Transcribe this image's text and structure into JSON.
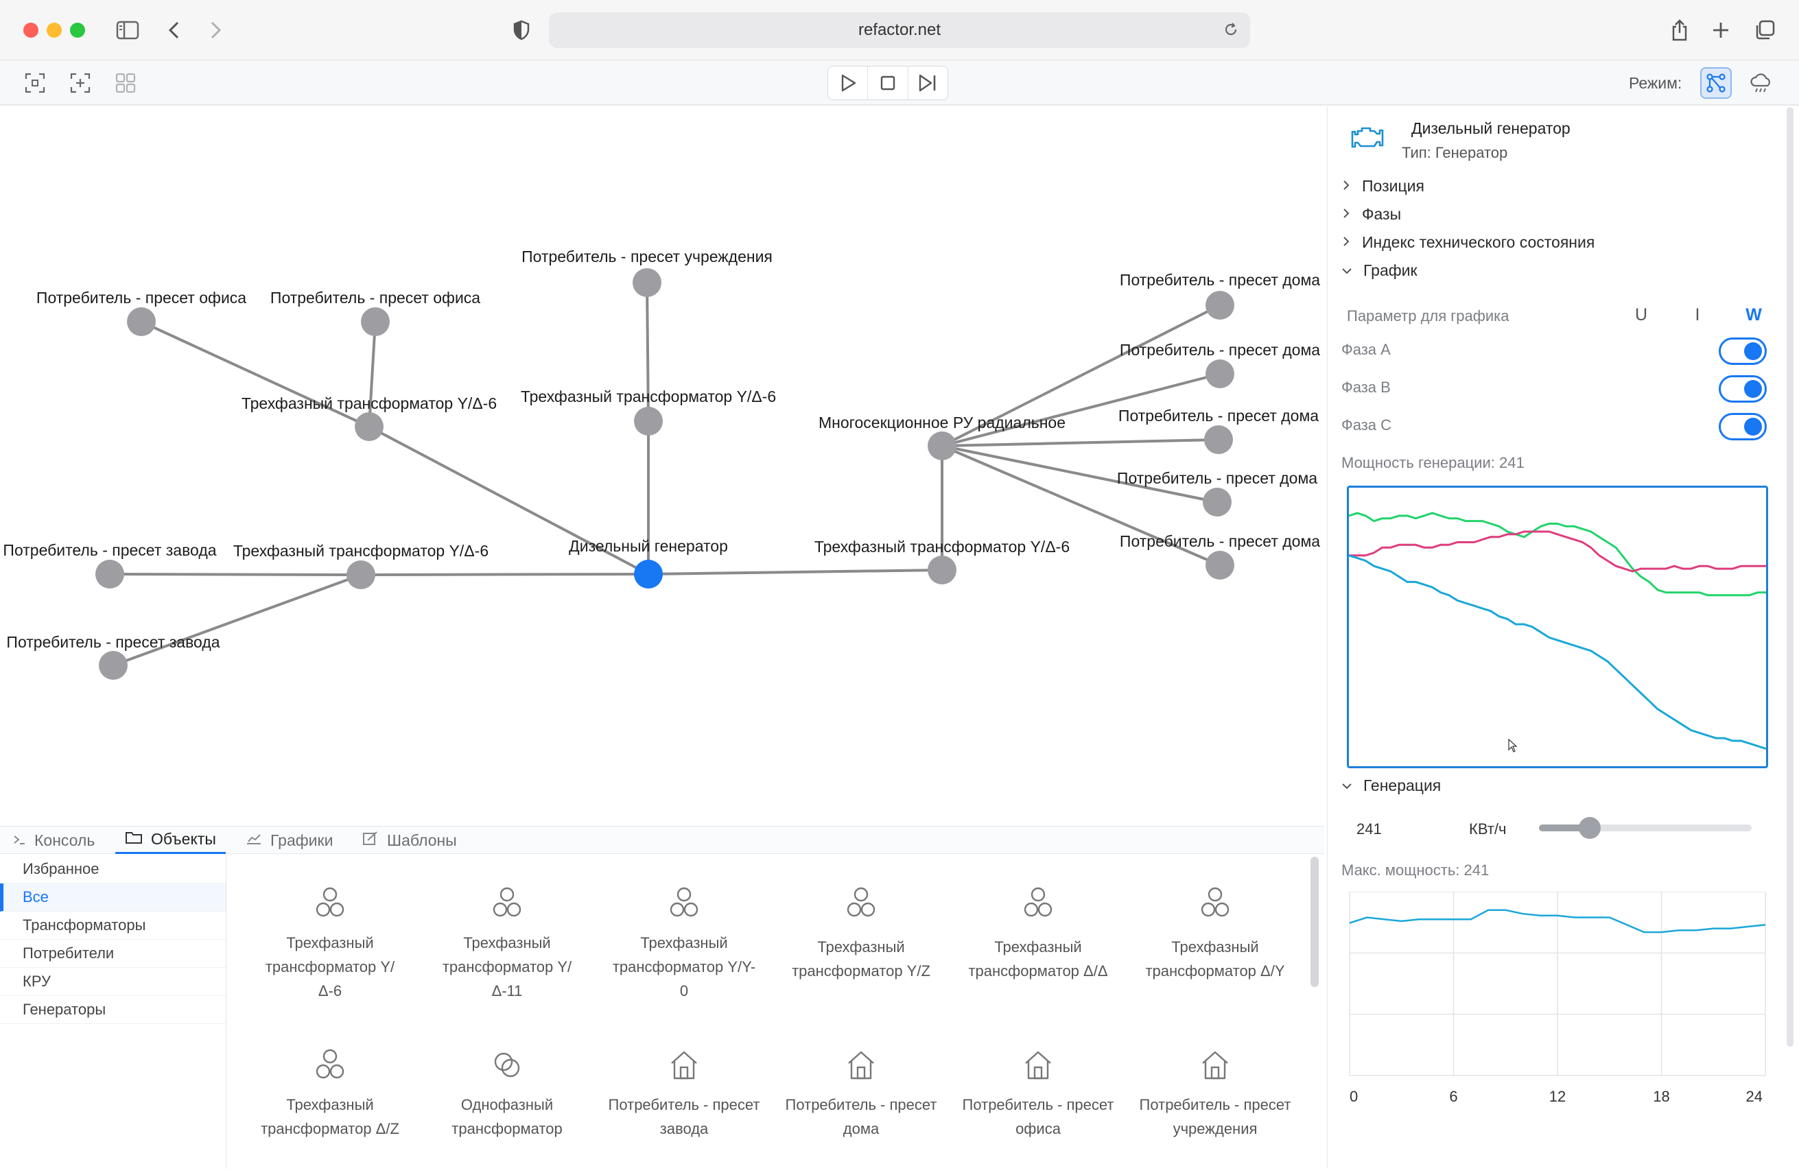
{
  "browser": {
    "url": "refactor.net"
  },
  "toolbar": {
    "mode_label": "Режим:"
  },
  "graph": {
    "nodes": [
      {
        "id": "gen",
        "label": "Дизельный генератор",
        "selected": true
      },
      {
        "id": "t1",
        "label": "Трехфазный трансформатор Y/Δ-6"
      },
      {
        "id": "t2",
        "label": "Трехфазный трансформатор Y/Δ-6"
      },
      {
        "id": "t3",
        "label": "Трехфазный трансформатор Y/Δ-6"
      },
      {
        "id": "t4",
        "label": "Трехфазный трансформатор Y/Δ-6"
      },
      {
        "id": "ru",
        "label": "Многосекционное РУ радиальное"
      },
      {
        "id": "o1",
        "label": "Потребитель - пресет офиса"
      },
      {
        "id": "o2",
        "label": "Потребитель - пресет офиса"
      },
      {
        "id": "u1",
        "label": "Потребитель - пресет учреждения"
      },
      {
        "id": "z1",
        "label": "Потребитель - пресет завода"
      },
      {
        "id": "z2",
        "label": "Потребитель - пресет завода"
      },
      {
        "id": "h1",
        "label": "Потребитель - пресет дома"
      },
      {
        "id": "h2",
        "label": "Потребитель - пресет дома"
      },
      {
        "id": "h3",
        "label": "Потребитель - пресет дома"
      },
      {
        "id": "h4",
        "label": "Потребитель - пресет дома"
      },
      {
        "id": "h5",
        "label": "Потребитель - пресет дома"
      }
    ],
    "edges": [
      [
        "gen",
        "t1"
      ],
      [
        "t1",
        "o1"
      ],
      [
        "t1",
        "o2"
      ],
      [
        "gen",
        "t2"
      ],
      [
        "t2",
        "u1"
      ],
      [
        "gen",
        "t3"
      ],
      [
        "t3",
        "z1"
      ],
      [
        "t3",
        "z2"
      ],
      [
        "gen",
        "t4"
      ],
      [
        "t4",
        "ru"
      ],
      [
        "ru",
        "h1"
      ],
      [
        "ru",
        "h2"
      ],
      [
        "ru",
        "h3"
      ],
      [
        "ru",
        "h4"
      ],
      [
        "ru",
        "h5"
      ]
    ],
    "colors": {
      "node": "#9e9ea2",
      "selected": "#1877f2",
      "edge": "#8a8a8d"
    }
  },
  "bottom": {
    "tabs": [
      {
        "label": "Консоль",
        "icon": "terminal-icon"
      },
      {
        "label": "Объекты",
        "icon": "folder-icon",
        "active": true
      },
      {
        "label": "Графики",
        "icon": "chart-icon"
      },
      {
        "label": "Шаблоны",
        "icon": "template-icon"
      }
    ],
    "categories": [
      {
        "label": "Избранное"
      },
      {
        "label": "Все",
        "active": true
      },
      {
        "label": "Трансформаторы"
      },
      {
        "label": "Потребители"
      },
      {
        "label": "КРУ"
      },
      {
        "label": "Генераторы"
      }
    ],
    "objects": [
      {
        "label": "Трехфазный трансформатор Y/Δ-6",
        "icon": "three-circles-icon"
      },
      {
        "label": "Трехфазный трансформатор Y/Δ-11",
        "icon": "three-circles-icon"
      },
      {
        "label": "Трехфазный трансформатор Y/Y-0",
        "icon": "three-circles-icon"
      },
      {
        "label": "Трехфазный трансформатор Y/Z",
        "icon": "three-circles-icon"
      },
      {
        "label": "Трехфазный трансформатор Δ/Δ",
        "icon": "three-circles-icon"
      },
      {
        "label": "Трехфазный трансформатор Δ/Y",
        "icon": "three-circles-icon"
      },
      {
        "label": "Трехфазный трансформатор Δ/Z",
        "icon": "three-circles-icon"
      },
      {
        "label": "Однофазный трансформатор",
        "icon": "two-circles-icon"
      },
      {
        "label": "Потребитель - пресет завода",
        "icon": "house-icon"
      },
      {
        "label": "Потребитель - пресет дома",
        "icon": "house-icon"
      },
      {
        "label": "Потребитель - пресет офиса",
        "icon": "house-icon"
      },
      {
        "label": "Потребитель - пресет учреждения",
        "icon": "house-icon"
      }
    ]
  },
  "panel": {
    "title": "Дизельный генератор",
    "type": "Тип: Генератор",
    "sections": [
      "Позиция",
      "Фазы",
      "Индекс технического состояния",
      "График"
    ],
    "param_label": "Параметр для графика",
    "params": [
      {
        "label": "U"
      },
      {
        "label": "I"
      },
      {
        "label": "W",
        "active": true
      }
    ],
    "phases": [
      {
        "label": "Фаза A",
        "on": true
      },
      {
        "label": "Фаза B",
        "on": true
      },
      {
        "label": "Фаза C",
        "on": true
      }
    ],
    "power_label": "Мощность генерации: 241",
    "generation_section": "Генерация",
    "gen_value": "241",
    "gen_unit": "КВт/ч",
    "gen_slider": 0.24,
    "max_power_label": "Макс. мощность: 241",
    "accent": "#1877f2"
  },
  "chart_data": [
    {
      "type": "line",
      "ylim": [
        0,
        100
      ],
      "series": [
        {
          "color": "#22d36b",
          "values": [
            92,
            93,
            92,
            90,
            91,
            91,
            92,
            92,
            91,
            92,
            93,
            92,
            91,
            91,
            90,
            90,
            90,
            89,
            88,
            86,
            85,
            84,
            86,
            88,
            89,
            89,
            88,
            88,
            87,
            86,
            84,
            82,
            80,
            76,
            72,
            69,
            67,
            64,
            63,
            63,
            63,
            63,
            63,
            62,
            62,
            62,
            62,
            62,
            62,
            63,
            63
          ]
        },
        {
          "color": "#de3d7e",
          "values": [
            77,
            77,
            77,
            78,
            80,
            80,
            81,
            81,
            81,
            80,
            80,
            81,
            81,
            82,
            82,
            82,
            83,
            84,
            84,
            85,
            85,
            86,
            86,
            86,
            86,
            85,
            84,
            83,
            82,
            80,
            77,
            75,
            73,
            72,
            71,
            72,
            72,
            72,
            72,
            73,
            72,
            72,
            73,
            73,
            72,
            72,
            72,
            73,
            73,
            73,
            73
          ]
        },
        {
          "color": "#1aa7d8",
          "values": [
            77,
            76,
            75,
            73,
            72,
            71,
            69,
            67,
            67,
            66,
            65,
            63,
            62,
            60,
            59,
            58,
            57,
            56,
            54,
            53,
            51,
            51,
            50,
            48,
            46,
            45,
            44,
            43,
            42,
            41,
            39,
            37,
            34,
            31,
            28,
            25,
            22,
            19,
            17,
            15,
            13,
            11,
            10,
            9,
            8,
            8,
            7,
            7,
            6,
            5,
            4
          ]
        }
      ]
    },
    {
      "type": "line",
      "x": [
        0,
        1,
        2,
        3,
        4,
        5,
        6,
        7,
        8,
        9,
        10,
        11,
        12,
        13,
        14,
        15,
        16,
        17,
        18,
        19,
        20,
        21,
        22,
        23,
        24
      ],
      "xticks": [
        "0",
        "6",
        "12",
        "18",
        "24"
      ],
      "xlim": [
        0,
        24
      ],
      "ylim": [
        0,
        100
      ],
      "series": [
        {
          "color": "#1aa7d8",
          "values": [
            83,
            86,
            85,
            84,
            85,
            85,
            85,
            85,
            90,
            90,
            88,
            87,
            87,
            86,
            86,
            86,
            82,
            78,
            78,
            79,
            79,
            80,
            80,
            81,
            82
          ]
        }
      ]
    }
  ]
}
